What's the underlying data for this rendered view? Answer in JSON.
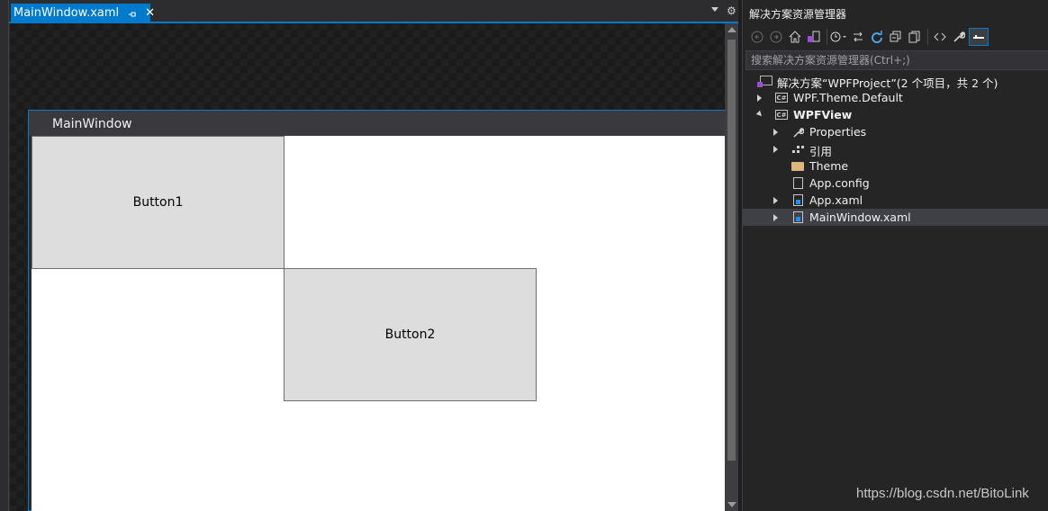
{
  "editor": {
    "tab_label": "MainWindow.xaml",
    "tab_close": "✕"
  },
  "designer": {
    "window_title": "MainWindow",
    "button1": "Button1",
    "button2": "Button2"
  },
  "explorer": {
    "title": "解决方案资源管理器",
    "search_placeholder": "搜索解决方案资源管理器(Ctrl+;)",
    "tree": {
      "solution": "解决方案“WPFProject”(2 个项目，共 2 个)",
      "project1": "WPF.Theme.Default",
      "project2": "WPFView",
      "properties": "Properties",
      "references": "引用",
      "theme_folder": "Theme",
      "app_config": "App.config",
      "app_xaml": "App.xaml",
      "mainwindow_xaml": "MainWindow.xaml"
    }
  },
  "watermark": "https://blog.csdn.net/BitoLink",
  "colors": {
    "accent": "#007acc",
    "background": "#2d2d30",
    "button_face": "#dddddd"
  }
}
